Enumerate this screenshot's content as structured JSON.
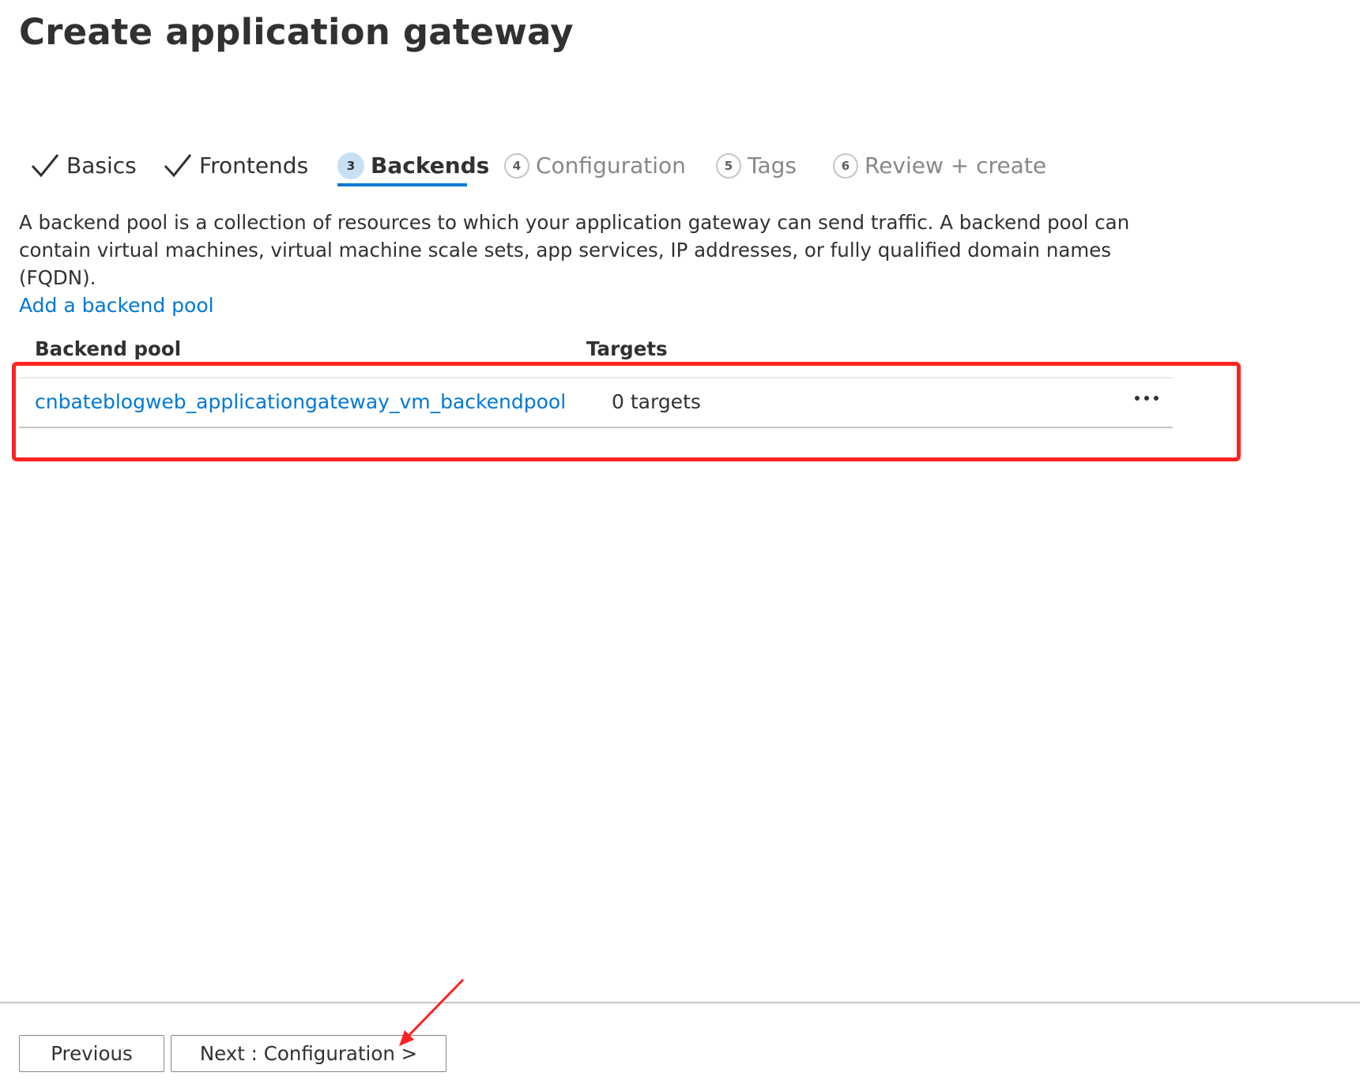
{
  "page": {
    "title": "Create application gateway"
  },
  "wizard": {
    "tabs": [
      {
        "label": "Basics",
        "state": "completed",
        "icon": "checkmark-icon"
      },
      {
        "label": "Frontends",
        "state": "completed",
        "icon": "checkmark-icon"
      },
      {
        "label": "Backends",
        "state": "active",
        "step": "3"
      },
      {
        "label": "Configuration",
        "state": "inactive",
        "step": "4"
      },
      {
        "label": "Tags",
        "state": "inactive",
        "step": "5"
      },
      {
        "label": "Review + create",
        "state": "inactive",
        "step": "6"
      }
    ]
  },
  "description": "A backend pool is a collection of resources to which your application gateway can send traffic. A backend pool can contain virtual machines, virtual machine scale sets, app services, IP addresses, or fully qualified domain names (FQDN).",
  "add_link": "Add a backend pool",
  "table": {
    "columns": {
      "pool": "Backend pool",
      "targets": "Targets"
    },
    "rows": [
      {
        "pool": "cnbateblogweb_applicationgateway_vm_backendpool",
        "targets": "0 targets",
        "more_icon": "ellipsis-icon"
      }
    ]
  },
  "footer": {
    "previous_label": "Previous",
    "next_label": "Next : Configuration >"
  },
  "colors": {
    "accent": "#0078d4",
    "annotation": "#ff2222",
    "active_step_fill": "#c7e0f4"
  }
}
